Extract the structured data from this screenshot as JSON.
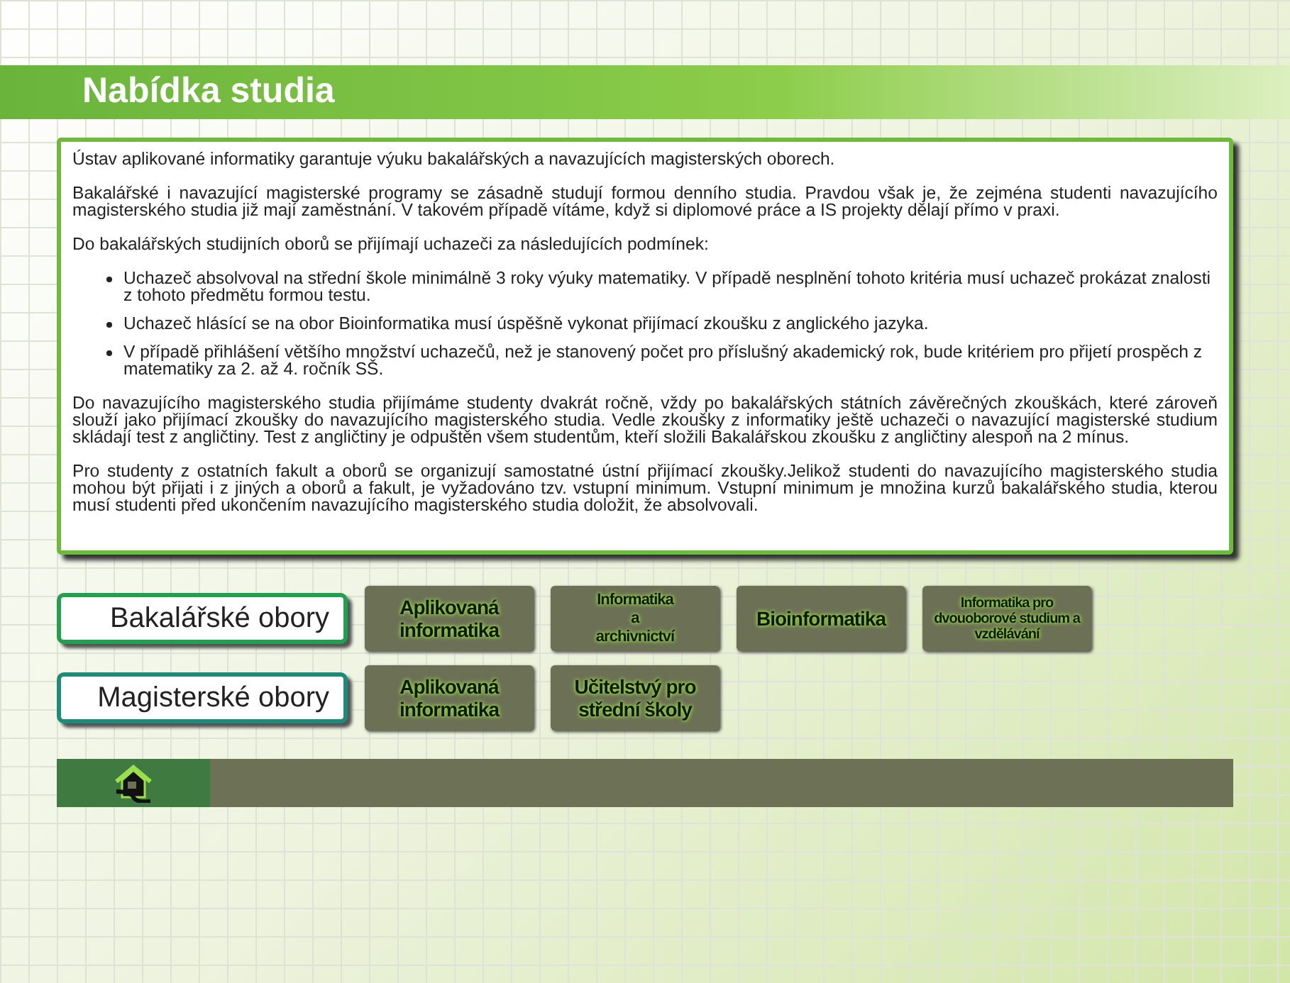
{
  "title": "Nabídka studia",
  "content": [
    {
      "kind": "paragraph",
      "text": "Ústav aplikované informatiky garantuje výuku bakalářských a navazujících magisterských oborech."
    },
    {
      "kind": "paragraph",
      "text": "Bakalářské i navazující magisterské programy se zásadně studují formou denního studia. Pravdou však je, že zejména studenti navazujícího magisterského studia již mají zaměstnání. V takovém případě vítáme, když si diplomové práce a IS projekty dělají přímo v praxi."
    },
    {
      "kind": "paragraph",
      "text": "Do bakalářských studijních oborů se přijímají uchazeči za následujících podmínek:"
    },
    {
      "kind": "list",
      "items": [
        "Uchazeč absolvoval na střední škole minimálně 3 roky výuky matematiky. V případě nesplnění tohoto kritéria musí uchazeč prokázat znalosti z tohoto předmětu formou testu.",
        "Uchazeč hlásící se na obor Bioinformatika musí úspěšně vykonat přijímací zkoušku z anglického jazyka.",
        "V případě přihlášení většího množství uchazečů, než je stanovený počet pro příslušný akademický rok, bude kritériem pro přijetí prospěch z matematiky za 2.  až 4. ročník SŠ."
      ]
    },
    {
      "kind": "paragraph",
      "text": "Do navazujícího magisterského studia přijímáme studenty dvakrát ročně, vždy po bakalářských státních závěrečných zkouškách, které zároveň slouží jako přijímací zkoušky do navazujícího magisterského studia. Vedle zkoušky z informatiky ještě uchazeči o navazující magisterské studium skládají test z angličtiny. Test z angličtiny je odpuštěn všem studentům, kteří složili Bakalářskou zkoušku z angličtiny alespoň na 2 mínus."
    },
    {
      "kind": "paragraph",
      "text": "Pro studenty z ostatních fakult a oborů se organizují samostatné ústní přijímací zkoušky.Jelikož studenti do navazujícího magisterského studia mohou být přijati i z jiných a oborů a fakult, je vyžadováno tzv. vstupní minimum. Vstupní minimum je množina kurzů bakalářského studia, kterou musí studenti před ukončením navazujícího magisterského studia doložit, že absolvovali."
    }
  ],
  "programs": [
    {
      "label": "Bakalářské obory",
      "color": "#22a050",
      "fields": [
        {
          "label": "Aplikovaná informatika",
          "kind": "large"
        },
        {
          "label": "Informatika\na\narchivnictví",
          "kind": "small"
        },
        {
          "label": "Bioinformatika",
          "kind": "large"
        },
        {
          "label": "Informatika pro dvouoborové studium a vzdělávání",
          "kind": "tiny"
        }
      ]
    },
    {
      "label": "Magisterské obory",
      "color": "#1e8a78",
      "fields": [
        {
          "label": "Aplikovaná informatika",
          "kind": "large"
        },
        {
          "label": "Učitelstvý pro střední školy",
          "kind": "large"
        }
      ]
    }
  ]
}
